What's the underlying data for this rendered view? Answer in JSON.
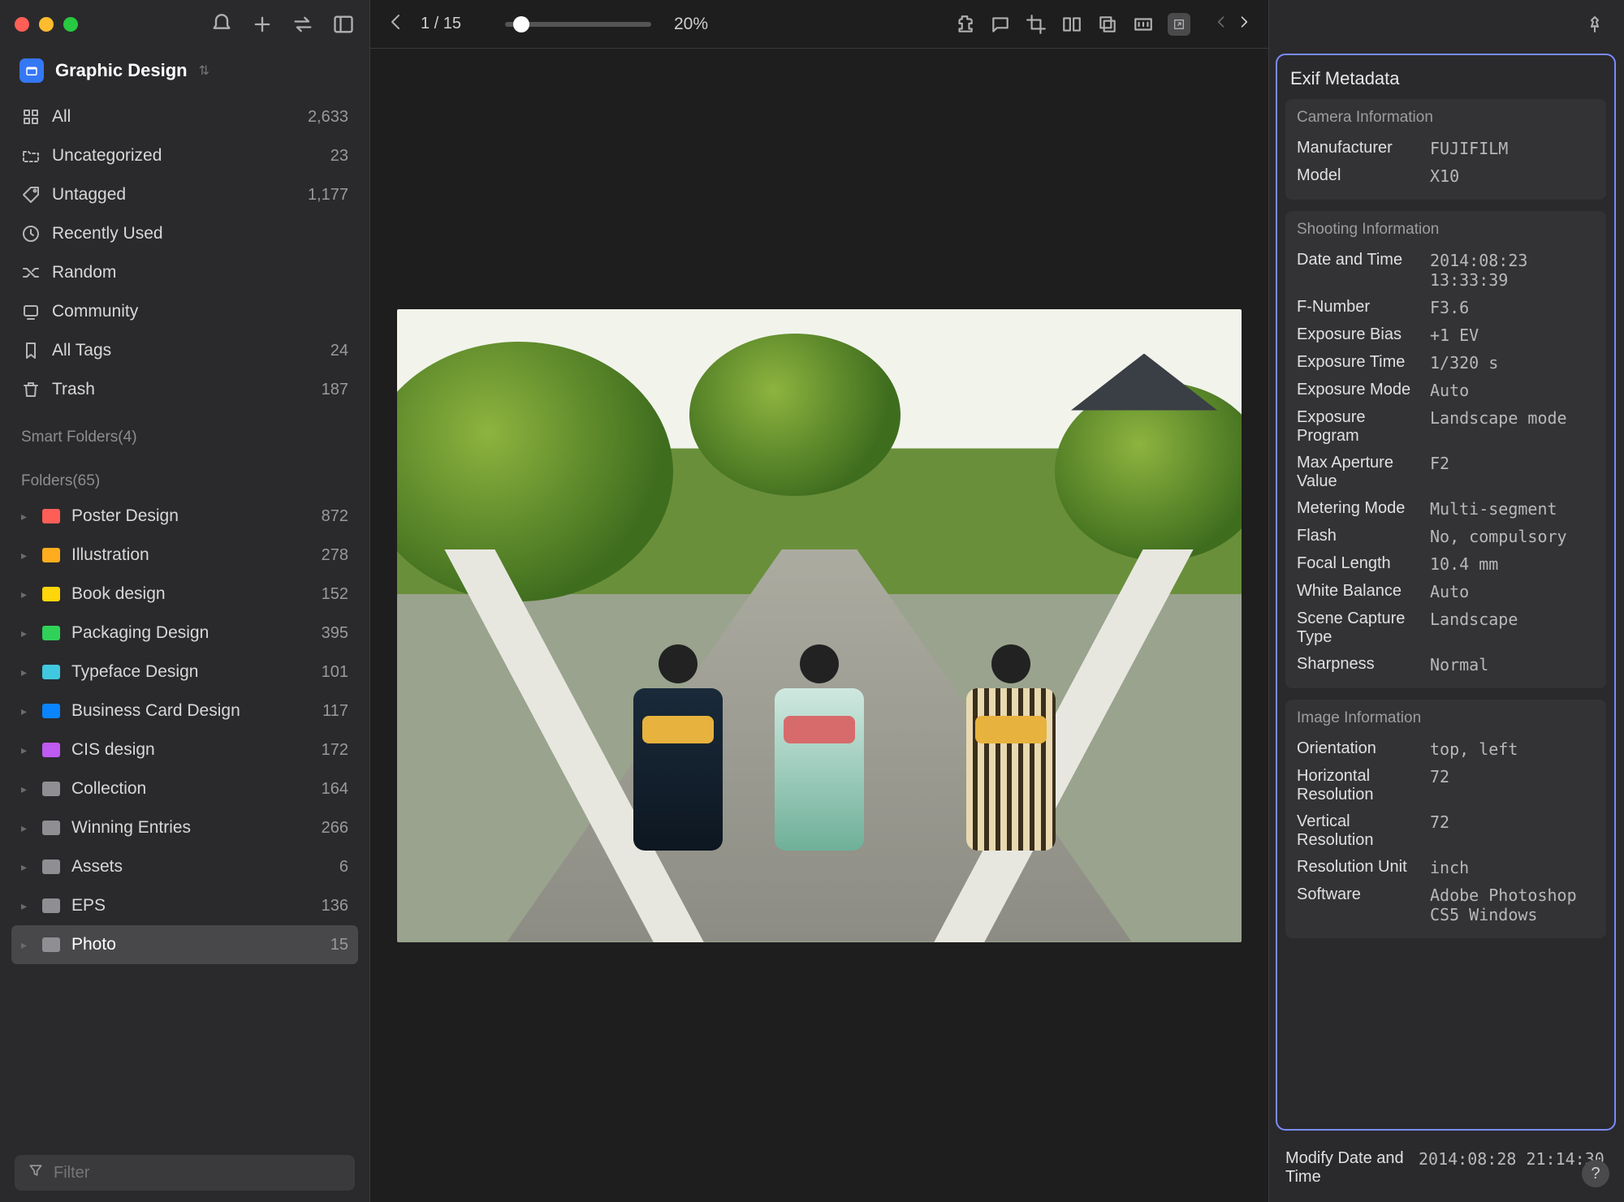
{
  "library": {
    "name": "Graphic Design"
  },
  "sidebar": {
    "items": [
      {
        "label": "All",
        "count": "2,633",
        "icon": "all"
      },
      {
        "label": "Uncategorized",
        "count": "23",
        "icon": "folder"
      },
      {
        "label": "Untagged",
        "count": "1,177",
        "icon": "tag"
      },
      {
        "label": "Recently Used",
        "count": "",
        "icon": "clock"
      },
      {
        "label": "Random",
        "count": "",
        "icon": "shuffle"
      },
      {
        "label": "Community",
        "count": "",
        "icon": "community"
      },
      {
        "label": "All Tags",
        "count": "24",
        "icon": "bookmark"
      },
      {
        "label": "Trash",
        "count": "187",
        "icon": "trash"
      }
    ],
    "smart_header": "Smart Folders(4)",
    "folders_header": "Folders(65)",
    "folders": [
      {
        "label": "Poster Design",
        "count": "872",
        "color": "red"
      },
      {
        "label": "Illustration",
        "count": "278",
        "color": "orange"
      },
      {
        "label": "Book design",
        "count": "152",
        "color": "yellow"
      },
      {
        "label": "Packaging Design",
        "count": "395",
        "color": "green"
      },
      {
        "label": "Typeface Design",
        "count": "101",
        "color": "teal"
      },
      {
        "label": "Business Card Design",
        "count": "117",
        "color": "blue"
      },
      {
        "label": "CIS design",
        "count": "172",
        "color": "purple"
      },
      {
        "label": "Collection",
        "count": "164",
        "color": "gray"
      },
      {
        "label": "Winning Entries",
        "count": "266",
        "color": "gray"
      },
      {
        "label": "Assets",
        "count": "6",
        "color": "gray"
      },
      {
        "label": "EPS",
        "count": "136",
        "color": "gray"
      },
      {
        "label": "Photo",
        "count": "15",
        "color": "gray",
        "active": true
      }
    ],
    "filter_placeholder": "Filter"
  },
  "viewer": {
    "page": "1 / 15",
    "zoom": "20%"
  },
  "exif": {
    "panel_title": "Exif Metadata",
    "camera_header": "Camera Information",
    "camera": {
      "Manufacturer": "FUJIFILM",
      "Model": "X10"
    },
    "shooting_header": "Shooting Information",
    "shooting": {
      "Date and Time": "2014:08:23 13:33:39",
      "F-Number": "F3.6",
      "Exposure Bias": "+1 EV",
      "Exposure Time": "1/320 s",
      "Exposure Mode": "Auto",
      "Exposure Program": "Landscape mode",
      "Max Aperture Value": "F2",
      "Metering Mode": "Multi-segment",
      "Flash": "No, compulsory",
      "Focal Length": "10.4 mm",
      "White Balance": "Auto",
      "Scene Capture Type": "Landscape",
      "Sharpness": "Normal"
    },
    "image_header": "Image Information",
    "image": {
      "Orientation": "top, left",
      "Horizontal Resolution": "72",
      "Vertical Resolution": "72",
      "Resolution Unit": "inch",
      "Software": "Adobe Photoshop CS5 Windows"
    },
    "trailing": {
      "Modify Date and Time": "2014:08:28 21:14:30"
    }
  }
}
